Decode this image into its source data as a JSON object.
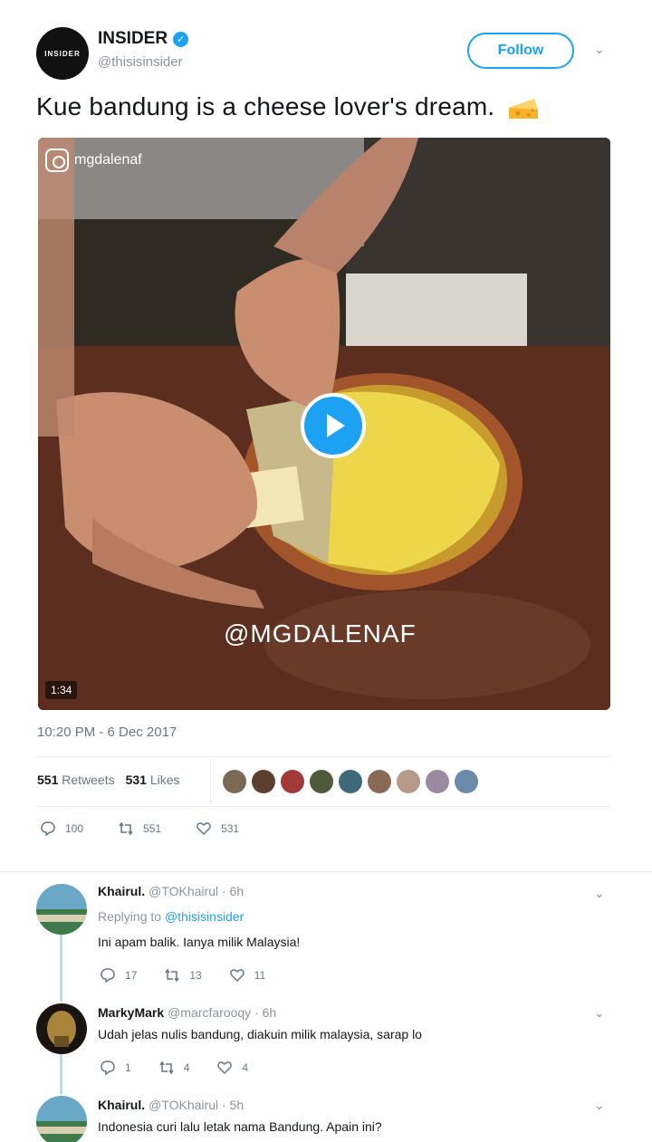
{
  "tweet": {
    "author_name": "INSIDER",
    "author_handle": "@thisisinsider",
    "avatar_text": "INSIDER",
    "follow_label": "Follow",
    "text": "Kue bandung is a cheese lover's dream.",
    "media": {
      "ig_handle": "mgdalenaf",
      "watermark": "@MGDALENAF",
      "duration": "1:34"
    },
    "timestamp": "10:20 PM - 6 Dec 2017",
    "retweets_count": "551",
    "retweets_label": "Retweets",
    "likes_count": "531",
    "likes_label": "Likes",
    "actions": {
      "replies": "100",
      "retweets": "551",
      "likes": "531"
    }
  },
  "replies": [
    {
      "name": "Khairul.",
      "handle": "@TOKhairul",
      "time": "· 6h",
      "replying_prefix": "Replying to",
      "replying_to": "@thisisinsider",
      "text": "Ini apam balik. Ianya milik Malaysia!",
      "replies": "17",
      "retweets": "13",
      "likes": "11"
    },
    {
      "name": "MarkyMark",
      "handle": "@marcfarooqy",
      "time": "· 6h",
      "text": "Udah jelas nulis bandung, diakuin milik malaysia, sarap lo",
      "replies": "1",
      "retweets": "4",
      "likes": "4"
    },
    {
      "name": "Khairul.",
      "handle": "@TOKhairul",
      "time": "· 5h",
      "text": "Indonesia curi lalu letak nama Bandung. Apain ini?"
    }
  ],
  "colors": {
    "accent": "#1da1f2",
    "muted": "#8a949e",
    "text": "#14171a"
  },
  "icons": [
    "verified-icon",
    "chevron-down-icon",
    "cheese-emoji-icon",
    "instagram-icon",
    "play-icon",
    "reply-icon",
    "retweet-icon",
    "like-icon"
  ]
}
